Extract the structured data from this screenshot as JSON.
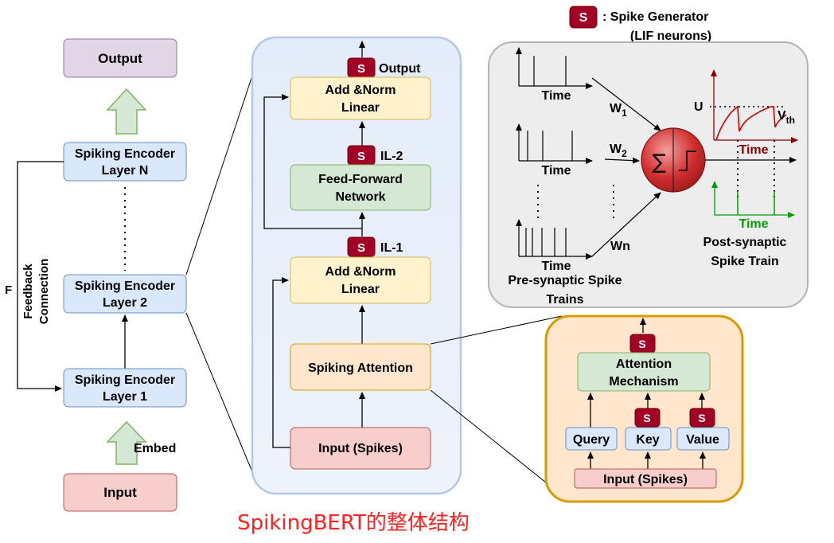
{
  "legend": {
    "s_symbol": "S",
    "text": ": Spike Generator",
    "sub": "(LIF neurons)"
  },
  "left": {
    "output": "Output",
    "layer_n_1": "Spiking Encoder",
    "layer_n_2": "Layer N",
    "layer_2_1": "Spiking Encoder",
    "layer_2_2": "Layer 2",
    "layer_1_1": "Spiking Encoder",
    "layer_1_2": "Layer 1",
    "input": "Input",
    "embed": "Embed",
    "feedback_1": "Feedback",
    "feedback_2": "Connection",
    "f": "F"
  },
  "middle": {
    "output_label": "Output",
    "addnorm_top_1": "Add &Norm",
    "addnorm_top_2": "Linear",
    "il2": "IL-2",
    "ffn_1": "Feed-Forward",
    "ffn_2": "Network",
    "il1": "IL-1",
    "addnorm_bot_1": "Add &Norm",
    "addnorm_bot_2": "Linear",
    "attention": "Spiking Attention",
    "input": "Input (Spikes)"
  },
  "neuron": {
    "time": "Time",
    "w1": "W",
    "w1_sub": "1",
    "w2": "W",
    "w2_sub": "2",
    "wn": "Wn",
    "pre_1": "Pre-synaptic Spike",
    "pre_2": "Trains",
    "u": "U",
    "vth": "V",
    "vth_sub": "th",
    "time_red": "Time",
    "time_green": "Time",
    "post_1": "Post-synaptic",
    "post_2": "Spike Train"
  },
  "attention_detail": {
    "mech_1": "Attention",
    "mech_2": "Mechanism",
    "query": "Query",
    "key": "Key",
    "value": "Value",
    "input": "Input (Spikes)"
  },
  "caption": "SpikingBERT的整体结构",
  "colors": {
    "blue_fill": "#dae8fc",
    "blue_stroke": "#6c8ebf",
    "purple_fill": "#e1d5e7",
    "purple_stroke": "#9673a6",
    "red_fill": "#f8cecc",
    "red_stroke": "#b85450",
    "yellow_fill": "#fff2cc",
    "yellow_stroke": "#d6b656",
    "green_fill": "#d5e8d4",
    "green_stroke": "#82b366",
    "spike_red": "#a20025",
    "orange_border": "#d79b00",
    "panel_gray": "#ededed"
  }
}
